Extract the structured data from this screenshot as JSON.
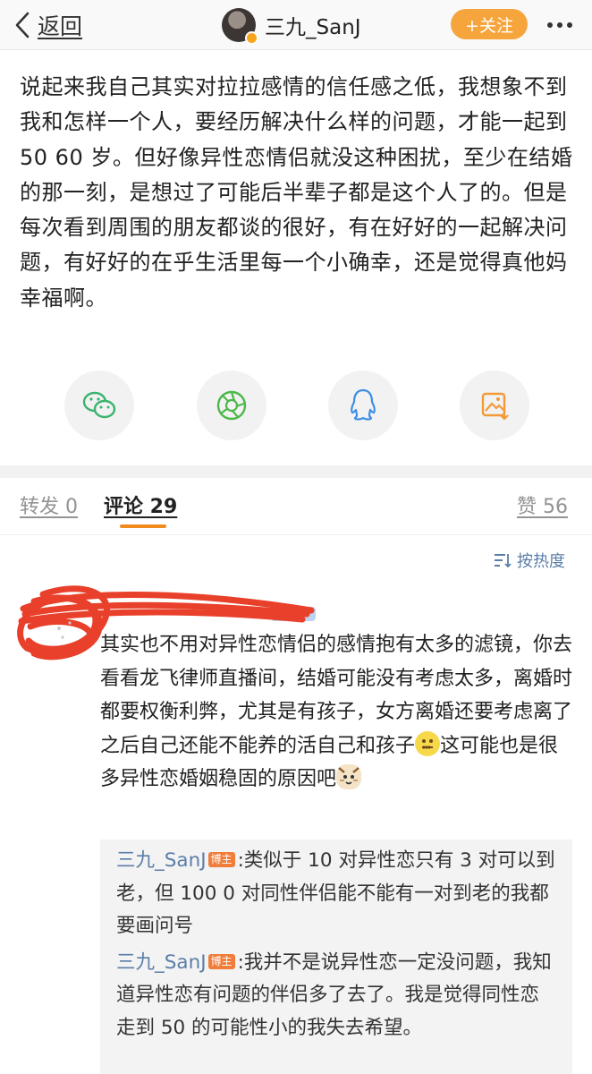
{
  "nav": {
    "back_label": "返回",
    "username": "三九_SanJ",
    "follow_label": "+关注"
  },
  "post": {
    "text": "说起来我自己其实对拉拉感情的信任感之低，我想象不到我和怎样一个人，要经历解决什么样的问题，才能一起到 50 60 岁。但好像异性恋情侣就没这种困扰，至少在结婚的那一刻，是想过了可能后半辈子都是这个人了的。但是每次看到周围的朋友都谈的很好，有在好好的一起解决问题，有好好的在乎生活里每一个小确幸，还是觉得真他妈幸福啊。"
  },
  "share": {
    "icons": [
      "wechat-icon",
      "moments-icon",
      "qq-icon",
      "save-image-icon"
    ]
  },
  "tabs": {
    "repost": "转发 0",
    "comments": "评论 29",
    "likes": "赞 56"
  },
  "sort_label": "按热度",
  "comment": {
    "text_a": "其实也不用对异性恋情侣的感情抱有太多的滤镜，你去看看龙飞律师直播间，结婚可能没有考虑太多，离婚时都要权衡利弊，尤其是有孩子，女方离婚还要考虑离了之后自己还能不能养的活自己和孩子",
    "text_b": "这可能也是很多异性恋婚姻稳固的原因吧"
  },
  "replies": [
    {
      "author": "三九_SanJ",
      "badge": "博主",
      "text": ":类似于 10 对异性恋只有 3 对可以到老，但 100 0 对同性伴侣能不能有一对到老的我都要画问号"
    },
    {
      "author": "三九_SanJ",
      "badge": "博主",
      "text": ":我并不是说异性恋一定没问题，我知道异性恋有问题的伴侣多了去了。我是觉得同性恋走到 50 的可能性小的我失去希望。"
    }
  ],
  "colors": {
    "accent": "#f28b1e",
    "link": "#5b7ea8",
    "redaction": "#e8402a"
  }
}
